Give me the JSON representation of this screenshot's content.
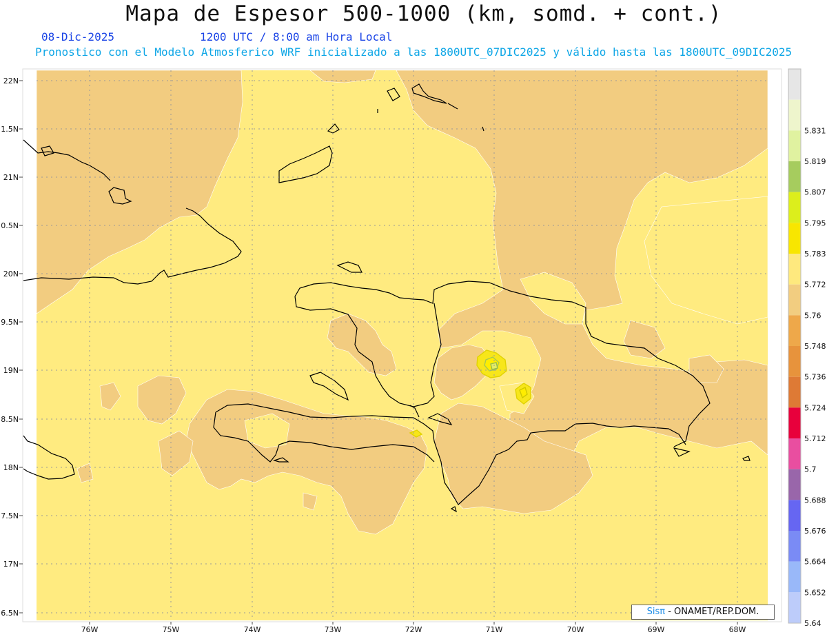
{
  "header": {
    "title": "Mapa de Espesor 500-1000 (km, somd. + cont.)",
    "date": "08-Dic-2025",
    "time": "1200 UTC / 8:00 am Hora Local",
    "description": "Pronostico con el Modelo Atmosferico WRF inicializado a las 1800UTC_07DIC2025 y válido hasta las  1800UTC_09DIC2025"
  },
  "map": {
    "lat_labels": [
      "22N",
      "1.5N",
      "21N",
      "0.5N",
      "20N",
      "9.5N",
      "19N",
      "8.5N",
      "18N",
      "7.5N",
      "17N",
      "6.5N"
    ],
    "lon_labels": [
      "76W",
      "75W",
      "74W",
      "73W",
      "72W",
      "71W",
      "70W",
      "69W",
      "68W"
    ],
    "fill_colors": {
      "base": "#ffeb80",
      "lower": "#f2cc80",
      "high1": "#f7e61a",
      "high2": "#ffed00",
      "core": "#e3ec66"
    }
  },
  "legend": {
    "levels": [
      {
        "label": "",
        "color": "#e6e6e6"
      },
      {
        "label": "5.831",
        "color": "#eef5cc"
      },
      {
        "label": "5.819",
        "color": "#e0f2a0"
      },
      {
        "label": "5.807",
        "color": "#a6cc5e"
      },
      {
        "label": "5.795",
        "color": "#dcee1c"
      },
      {
        "label": "5.783",
        "color": "#f8e600"
      },
      {
        "label": "5.772",
        "color": "#fee97e"
      },
      {
        "label": "5.76",
        "color": "#f2cd80"
      },
      {
        "label": "5.748",
        "color": "#eea84a"
      },
      {
        "label": "5.736",
        "color": "#e7933c"
      },
      {
        "label": "5.724",
        "color": "#de7a35"
      },
      {
        "label": "5.712",
        "color": "#e8003c"
      },
      {
        "label": "5.7",
        "color": "#e94ea0"
      },
      {
        "label": "5.688",
        "color": "#9966aa"
      },
      {
        "label": "5.676",
        "color": "#6666f2"
      },
      {
        "label": "5.664",
        "color": "#7a8bf5"
      },
      {
        "label": "5.652",
        "color": "#99b8f9"
      },
      {
        "label": "5.64",
        "color": "#bdccfa"
      }
    ]
  },
  "credit": {
    "sis": "Sisπ",
    "rest": " - ONAMET/REP.DOM."
  }
}
